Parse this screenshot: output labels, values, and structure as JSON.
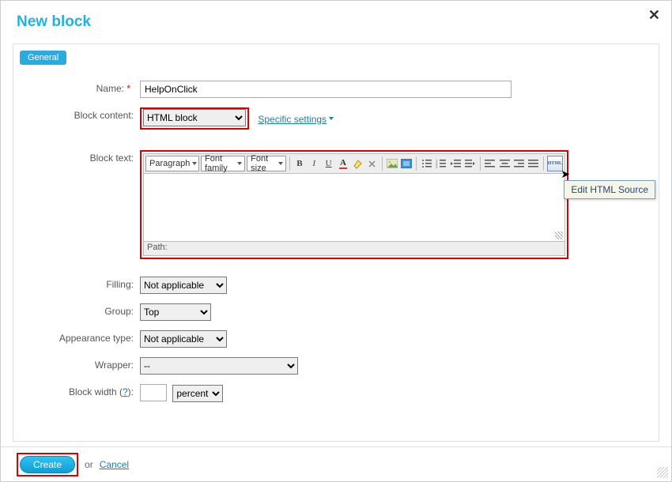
{
  "title": "New block",
  "tab": {
    "general": "General"
  },
  "labels": {
    "name": "Name:",
    "block_content": "Block content:",
    "block_text": "Block text:",
    "filling": "Filling:",
    "group": "Group:",
    "appearance": "Appearance type:",
    "wrapper": "Wrapper:",
    "block_width_pre": "Block width (",
    "block_width_q": "?",
    "block_width_post": "):"
  },
  "values": {
    "name": "HelpOnClick",
    "block_content": "HTML block",
    "filling": "Not applicable",
    "group": "Top",
    "appearance": "Not applicable",
    "wrapper": "--",
    "block_width_num": "",
    "block_width_unit": "percent"
  },
  "links": {
    "specific_settings": "Specific settings"
  },
  "toolbar": {
    "paragraph": "Paragraph",
    "font_family": "Font family",
    "font_size": "Font size",
    "html_btn": "HTML"
  },
  "path_label": "Path:",
  "tooltip": "Edit HTML Source",
  "footer": {
    "create": "Create",
    "or": "or",
    "cancel": "Cancel"
  }
}
